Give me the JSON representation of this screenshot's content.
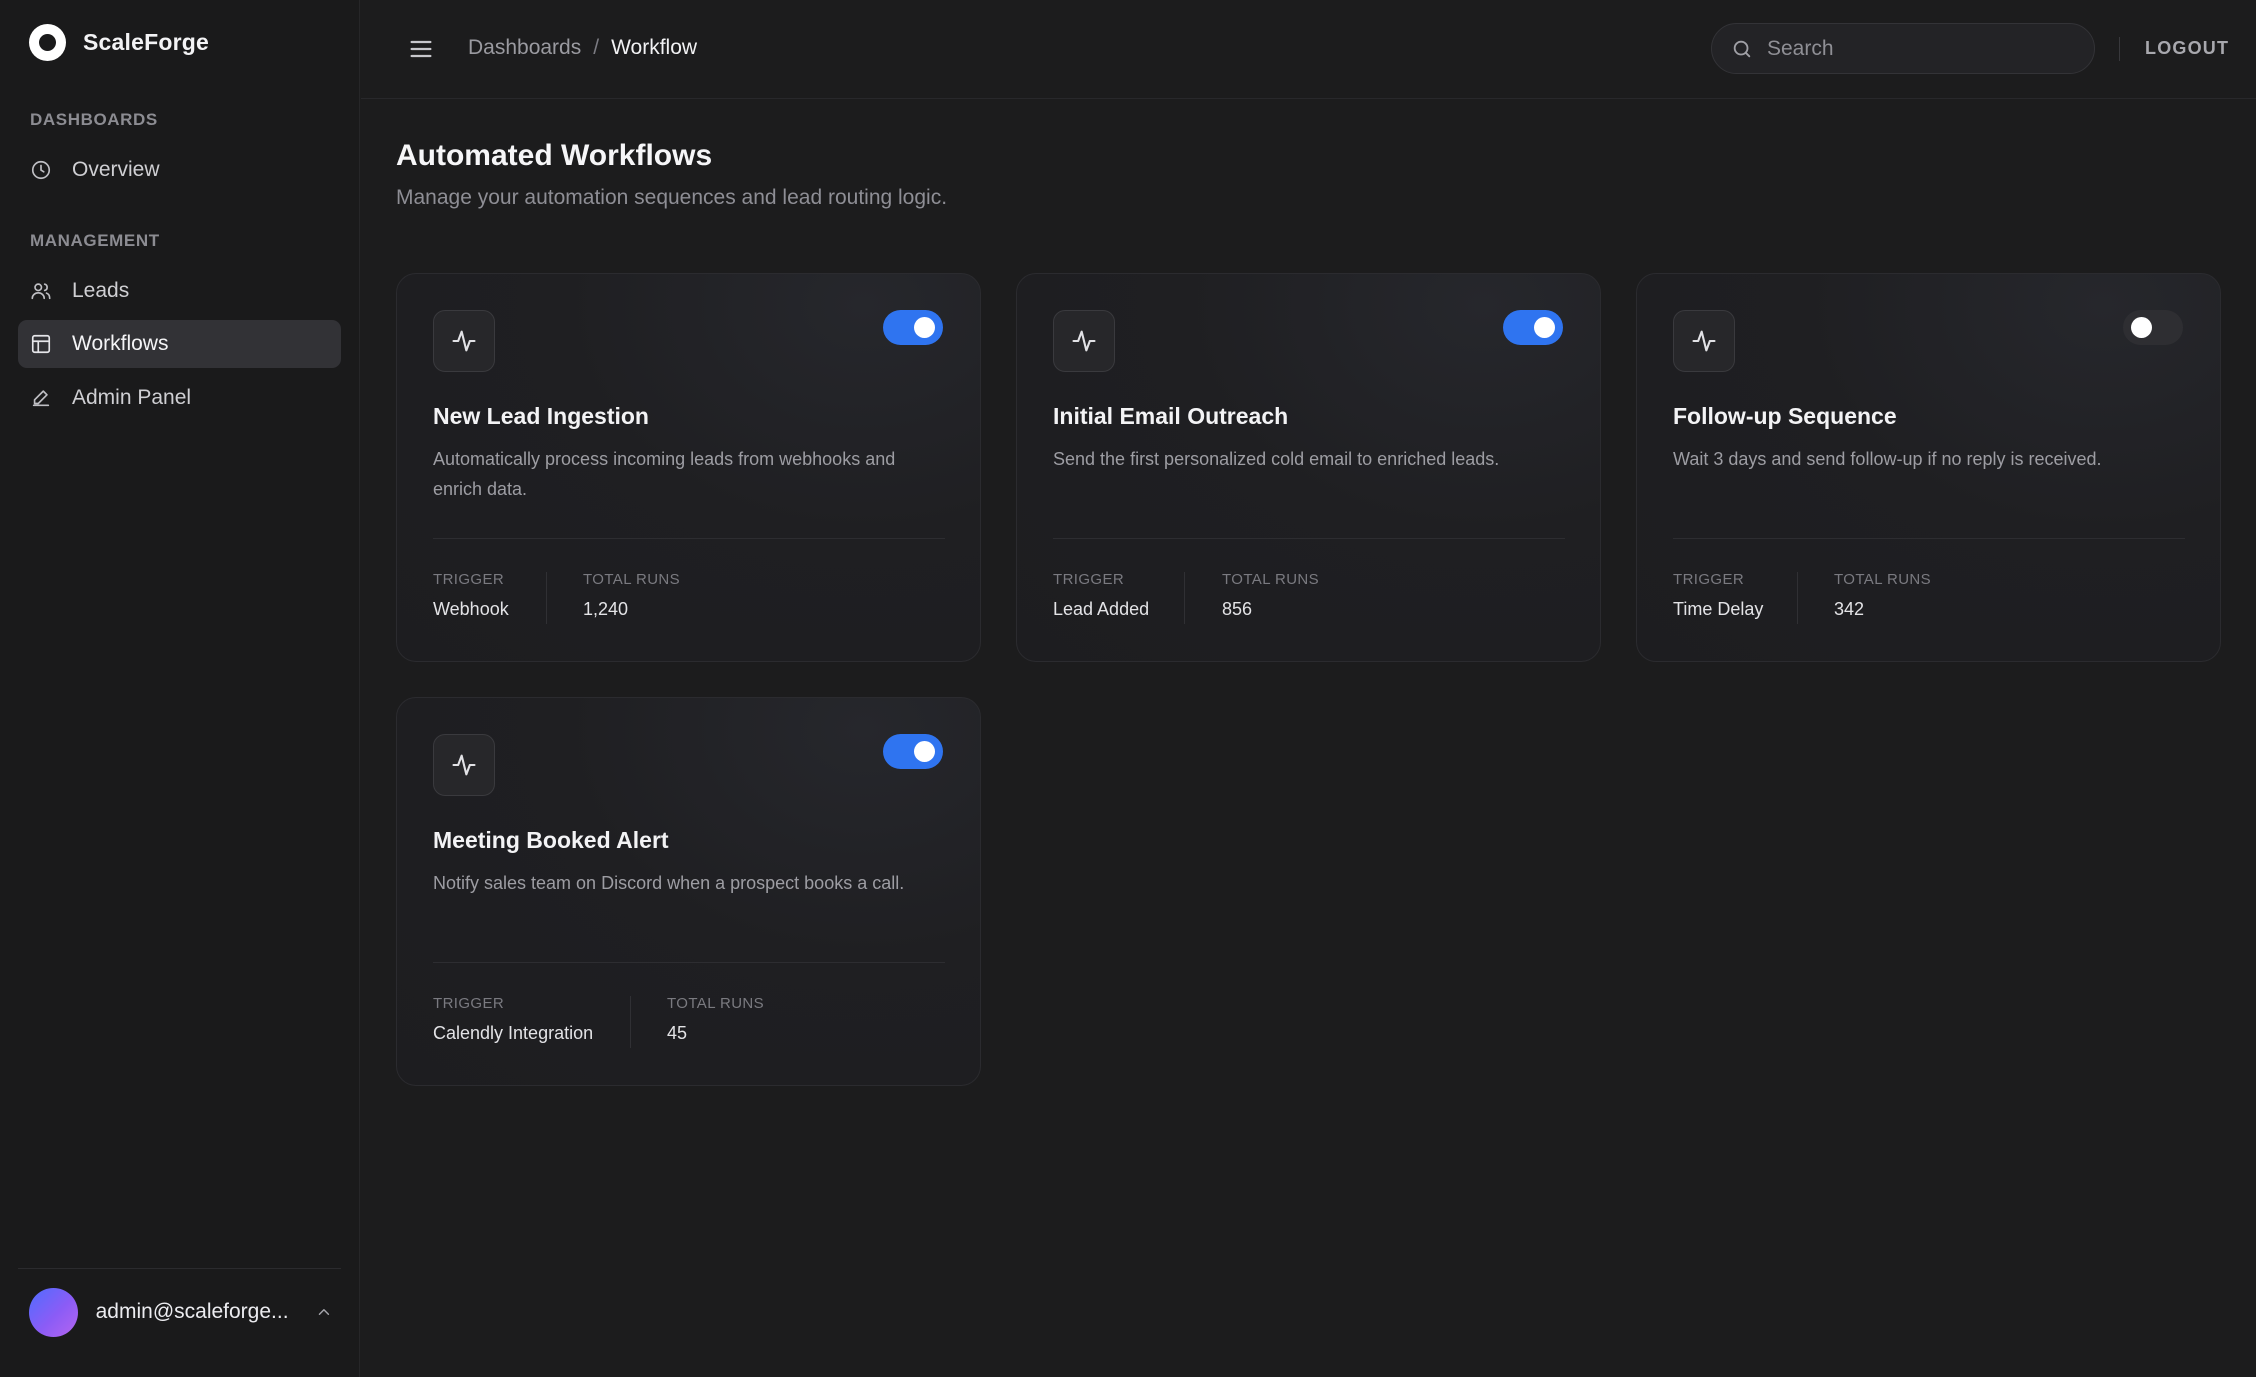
{
  "brand": {
    "name": "ScaleForge"
  },
  "sidebar": {
    "sections": [
      {
        "label": "DASHBOARDS",
        "items": [
          {
            "label": "Overview",
            "icon": "clock-icon"
          }
        ]
      },
      {
        "label": "MANAGEMENT",
        "items": [
          {
            "label": "Leads",
            "icon": "users-icon"
          },
          {
            "label": "Workflows",
            "icon": "layout-icon",
            "active": true
          },
          {
            "label": "Admin Panel",
            "icon": "pen-icon"
          }
        ]
      }
    ],
    "user": {
      "email": "admin@scaleforge..."
    }
  },
  "topbar": {
    "breadcrumb": {
      "parent": "Dashboards",
      "separator": "/",
      "current": "Workflow"
    },
    "search": {
      "placeholder": "Search",
      "value": ""
    },
    "logout_label": "LOGOUT"
  },
  "page": {
    "title": "Automated Workflows",
    "subtitle": "Manage your automation sequences and lead routing logic."
  },
  "labels": {
    "trigger": "TRIGGER",
    "total_runs": "TOTAL RUNS"
  },
  "workflows": [
    {
      "title": "New Lead Ingestion",
      "description": "Automatically process incoming leads from webhooks and enrich data.",
      "trigger": "Webhook",
      "total_runs": "1,240",
      "enabled": true
    },
    {
      "title": "Initial Email Outreach",
      "description": "Send the first personalized cold email to enriched leads.",
      "trigger": "Lead Added",
      "total_runs": "856",
      "enabled": true
    },
    {
      "title": "Follow-up Sequence",
      "description": "Wait 3 days and send follow-up if no reply is received.",
      "trigger": "Time Delay",
      "total_runs": "342",
      "enabled": false
    },
    {
      "title": "Meeting Booked Alert",
      "description": "Notify sales team on Discord when a prospect books a call.",
      "trigger": "Calendly Integration",
      "total_runs": "45",
      "enabled": true
    }
  ],
  "colors": {
    "accent": "#2f74f0",
    "background": "#1c1c1d",
    "sidebar": "#1a1a1b",
    "card": "#1f1f22"
  }
}
